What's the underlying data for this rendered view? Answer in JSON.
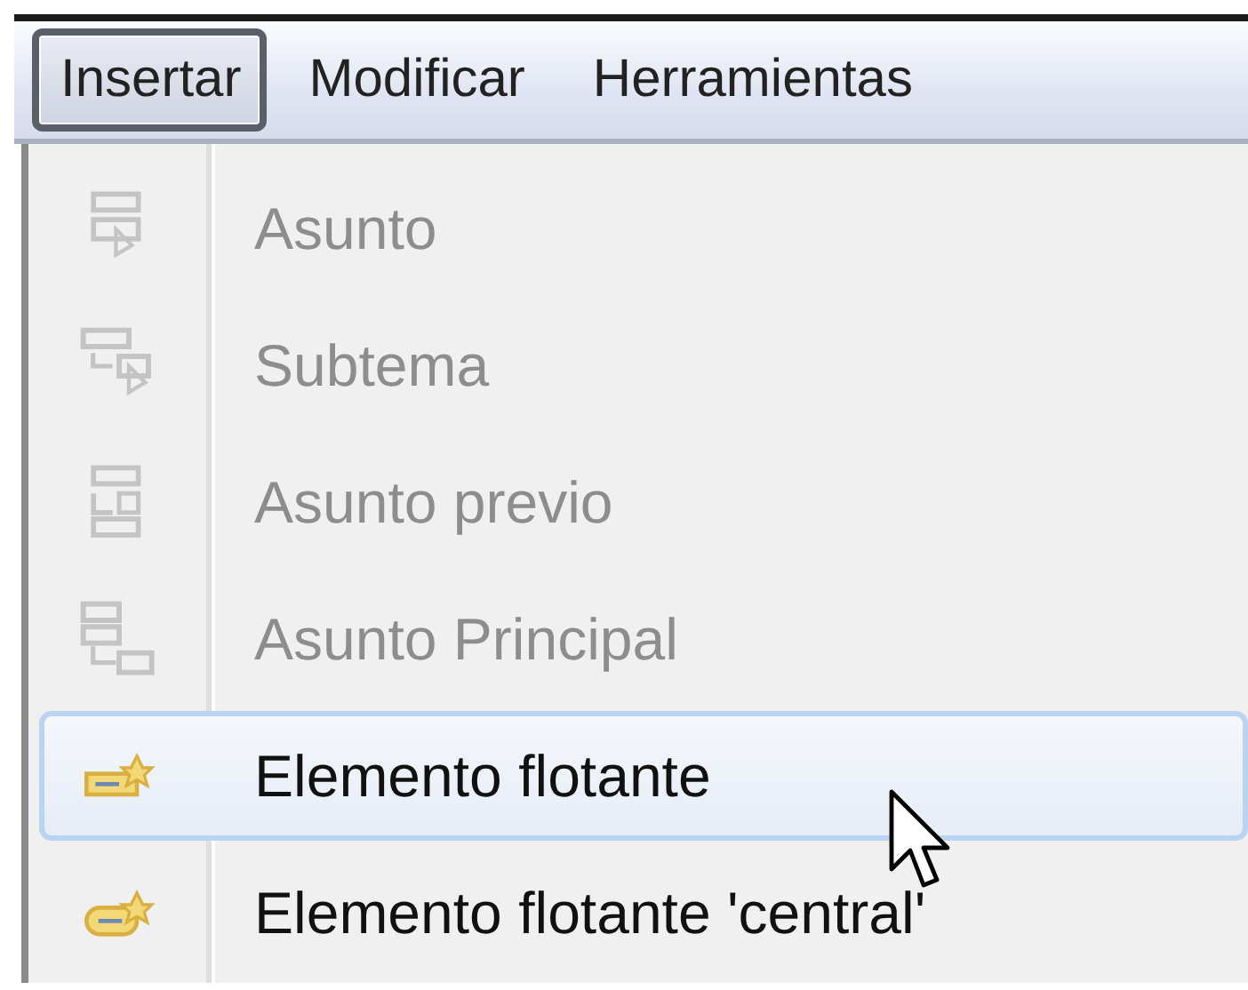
{
  "menubar": [
    {
      "label": "Insertar",
      "selected": true
    },
    {
      "label": "Modificar",
      "selected": false
    },
    {
      "label": "Herramientas",
      "selected": false
    }
  ],
  "menu": {
    "items": [
      {
        "label": "Asunto",
        "disabled": true,
        "selected": false
      },
      {
        "label": "Subtema",
        "disabled": true,
        "selected": false
      },
      {
        "label": "Asunto previo",
        "disabled": true,
        "selected": false
      },
      {
        "label": "Asunto Principal",
        "disabled": true,
        "selected": false
      },
      {
        "label": "Elemento flotante",
        "disabled": false,
        "selected": true
      },
      {
        "label": "Elemento flotante 'central'",
        "disabled": false,
        "selected": false
      }
    ]
  }
}
